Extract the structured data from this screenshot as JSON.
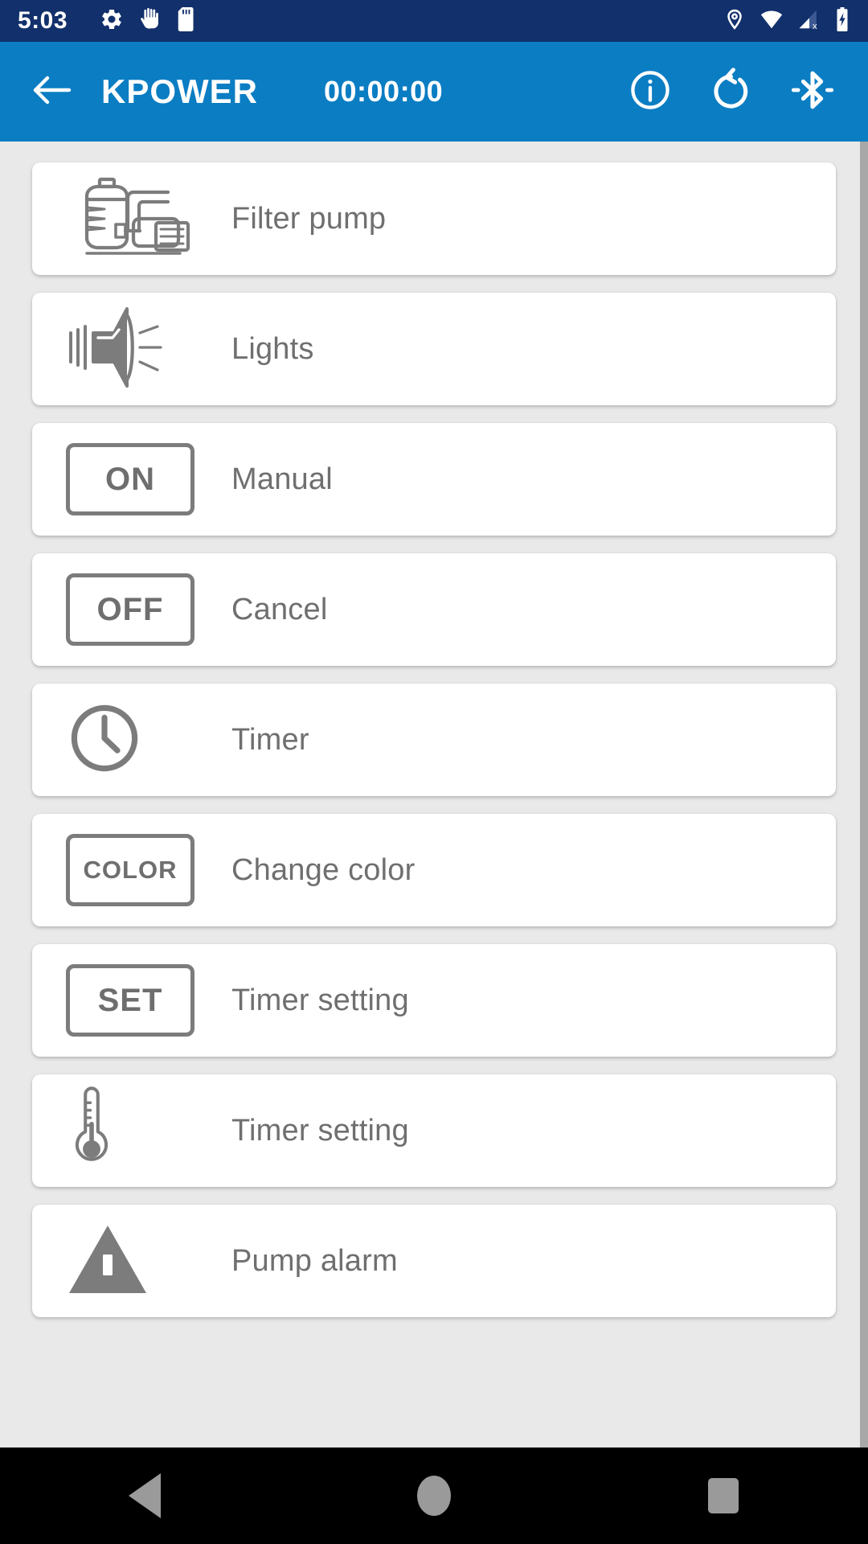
{
  "statusbar": {
    "time": "5:03",
    "left_icons": [
      "gear-icon",
      "hand-icon",
      "sd-card-icon"
    ],
    "right_icons": [
      "location-pin-icon",
      "wifi-icon",
      "cellular-signal-off-icon",
      "battery-charging-icon"
    ],
    "background_color": "#12306b"
  },
  "appbar": {
    "back_label": "back-arrow",
    "title": "KPOWER",
    "timer": "00:00:00",
    "actions": [
      {
        "name": "info-icon",
        "label": "Info"
      },
      {
        "name": "restore-icon",
        "label": "Restore"
      },
      {
        "name": "bluetooth-disabled-icon",
        "label": "Bluetooth"
      }
    ],
    "background_color": "#0b7dc3",
    "text_color": "#ffffff"
  },
  "list": {
    "items": [
      {
        "icon": "filter-pump-icon",
        "control": "icon",
        "label": "Filter pump"
      },
      {
        "icon": "pool-light-icon",
        "control": "icon",
        "label": "Lights"
      },
      {
        "icon": "on-button",
        "control": "button",
        "button_label": "ON",
        "label": "Manual"
      },
      {
        "icon": "off-button",
        "control": "button",
        "button_label": "OFF",
        "label": "Cancel"
      },
      {
        "icon": "clock-icon",
        "control": "icon",
        "label": "Timer"
      },
      {
        "icon": "color-button",
        "control": "button",
        "button_label": "COLOR",
        "label": "Change color"
      },
      {
        "icon": "set-button",
        "control": "button",
        "button_label": "SET",
        "label": "Timer setting"
      },
      {
        "icon": "thermometer-icon",
        "control": "icon",
        "label": "Timer setting"
      },
      {
        "icon": "warning-triangle-icon",
        "control": "icon",
        "label": "Pump alarm"
      }
    ],
    "icon_color": "#7c7c7c",
    "label_color": "#6f6f6f",
    "card_background": "#ffffff",
    "page_background": "#e9e9e9"
  },
  "navbar": {
    "back": "back-triangle",
    "home": "home-circle",
    "recents": "recents-square",
    "background_color": "#000000"
  }
}
